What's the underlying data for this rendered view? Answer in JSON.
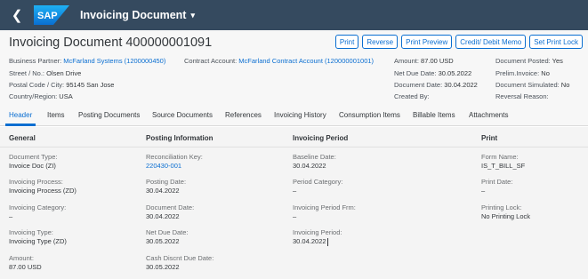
{
  "shell": {
    "title": "Invoicing Document",
    "back_icon": "back-arrow-icon",
    "caret": "▾"
  },
  "header": {
    "title": "Invoicing Document 400000001091",
    "actions": [
      "Print",
      "Reverse",
      "Print Preview",
      "Credit/ Debit Memo",
      "Set Print Lock"
    ],
    "col1": [
      {
        "label": "Business Partner:",
        "value": "McFarland Systems (1200000450)",
        "link": true
      },
      {
        "label": "Street / No.:",
        "value": "Olsen Drive"
      },
      {
        "label": "Postal Code / City:",
        "value": "95145 San Jose"
      },
      {
        "label": "Country/Region:",
        "value": "USA"
      }
    ],
    "col2": [
      {
        "label": "Contract Account:",
        "value": "McFarland Contract Account (120000001001)",
        "link": true
      }
    ],
    "col3": [
      {
        "label": "Amount:",
        "value": "87.00  USD"
      },
      {
        "label": "Net Due Date:",
        "value": "30.05.2022"
      },
      {
        "label": "Document Date:",
        "value": "30.04.2022"
      },
      {
        "label": "Created By:",
        "value": ""
      }
    ],
    "col4": [
      {
        "label": "Document Posted:",
        "value": "Yes"
      },
      {
        "label": "Prelim.Invoice:",
        "value": "No"
      },
      {
        "label": "Document Simulated:",
        "value": "No"
      },
      {
        "label": "Reversal Reason:",
        "value": ""
      }
    ]
  },
  "tabs": [
    "Header",
    "Items",
    "Posting Documents",
    "Source Documents",
    "References",
    "Invoicing History",
    "Consumption Items",
    "Billable Items",
    "Attachments"
  ],
  "sections": {
    "general": {
      "title": "General",
      "fields": [
        {
          "label": "Document Type:",
          "value": "Invoice Doc (ZI)"
        },
        {
          "label": "Invoicing Process:",
          "value": "Invoicing Process (ZD)"
        },
        {
          "label": "Invoicing Category:",
          "value": "–"
        },
        {
          "label": "Invoicing Type:",
          "value": "Invoicing Type (ZD)"
        },
        {
          "label": "Amount:",
          "value": "87.00  USD"
        }
      ]
    },
    "posting": {
      "title": "Posting Information",
      "fields": [
        {
          "label": "Reconciliation Key:",
          "value": "220430-001",
          "link": true
        },
        {
          "label": "Posting Date:",
          "value": "30.04.2022"
        },
        {
          "label": "Document Date:",
          "value": "30.04.2022"
        },
        {
          "label": "Net Due Date:",
          "value": "30.05.2022"
        },
        {
          "label": "Cash Discnt Due Date:",
          "value": "30.05.2022"
        }
      ]
    },
    "period": {
      "title": "Invoicing Period",
      "fields": [
        {
          "label": "Baseline Date:",
          "value": "30.04.2022"
        },
        {
          "label": "Period Category:",
          "value": "–"
        },
        {
          "label": "Invoicing Period Frm:",
          "value": "–"
        },
        {
          "label": "Invoicing Period:",
          "value": "30.04.2022"
        }
      ]
    },
    "print": {
      "title": "Print",
      "fields": [
        {
          "label": "Form Name:",
          "value": "IS_T_BILL_SF"
        },
        {
          "label": "Print Date:",
          "value": "–"
        },
        {
          "label": "Printing Lock:",
          "value": "No Printing Lock"
        }
      ]
    }
  }
}
